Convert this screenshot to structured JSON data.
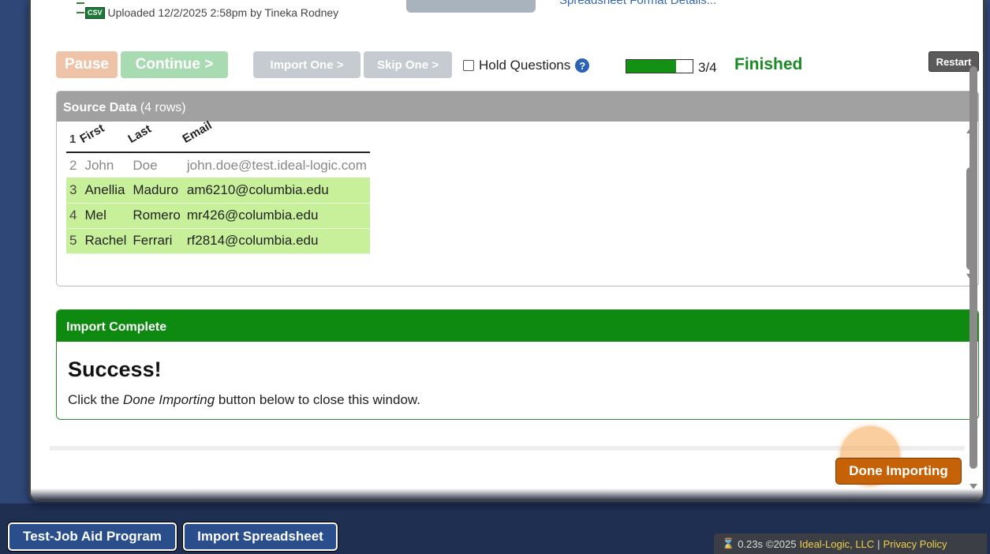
{
  "upload": {
    "icon_label": "CSV",
    "text": "Uploaded 12/2/2025 2:58pm by Tineka Rodney",
    "link": "Spreadsheet Format Details..."
  },
  "toolbar": {
    "pause_label": "Pause",
    "continue_label": "Continue >",
    "import_one_label": "Import One >",
    "skip_one_label": "Skip One >",
    "hold_questions_label": "Hold Questions",
    "hold_questions_checked": false,
    "help_icon": "?",
    "progress_text": "3/4",
    "progress_fraction": 0.75,
    "status": "Finished",
    "restart_label": "Restart"
  },
  "source_data": {
    "title": "Source Data",
    "row_count_text": "(4 rows)",
    "header_row": {
      "num": "1",
      "cols": [
        "First",
        "Last",
        "Email"
      ]
    },
    "rows": [
      {
        "num": "2",
        "first": "John",
        "last": "Doe",
        "email": "john.doe@test.ideal-logic.com",
        "state": "skipped"
      },
      {
        "num": "3",
        "first": "Anellia",
        "last": "Maduro",
        "email": "am6210@columbia.edu",
        "state": "imported"
      },
      {
        "num": "4",
        "first": "Mel",
        "last": "Romero",
        "email": "mr426@columbia.edu",
        "state": "imported"
      },
      {
        "num": "5",
        "first": "Rachel",
        "last": "Ferrari",
        "email": "rf2814@columbia.edu",
        "state": "imported"
      }
    ]
  },
  "import_complete": {
    "header": "Import Complete",
    "title": "Success!",
    "msg_before": "Click the ",
    "msg_emphasis": "Done Importing",
    "msg_after": " button below to close this window."
  },
  "done_button_label": "Done Importing",
  "taskbar": {
    "item1": "Test-Job Aid Program",
    "item2": "Import Spreadsheet"
  },
  "footer": {
    "timing": "0.23s",
    "copyright": "©2025",
    "company": "Ideal-Logic, LLC",
    "separator": "|",
    "privacy": "Privacy Policy"
  },
  "colors": {
    "finished": "#1a8a25",
    "imported_row": "#c8f09a",
    "complete_header": "#0e8a10",
    "done_button": "#c56208",
    "taskbar_button": "#2a4d8c"
  }
}
